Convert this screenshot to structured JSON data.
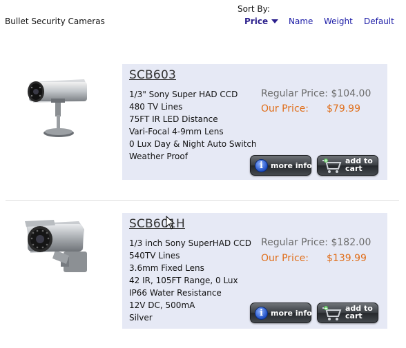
{
  "page": {
    "heading": "Bullet Security Cameras"
  },
  "sort": {
    "label": "Sort By:",
    "options": [
      {
        "label": "Price",
        "active": true
      },
      {
        "label": "Name",
        "active": false
      },
      {
        "label": "Weight",
        "active": false
      },
      {
        "label": "Default",
        "active": false
      }
    ]
  },
  "products": [
    {
      "name": "SCB603",
      "specs": [
        "1/3\" Sony Super HAD CCD",
        "480 TV Lines",
        "75FT IR LED Distance",
        "Vari-Focal 4-9mm Lens",
        "0 Lux Day & Night Auto Switch",
        "Weather Proof"
      ],
      "regular_price_label": "Regular Price:",
      "regular_price": "$104.00",
      "our_price_label": "Our Price:",
      "our_price": "$79.99",
      "more_info_label": "more info",
      "add_to_cart_line1": "add to",
      "add_to_cart_line2": "cart",
      "image_icon": "bullet-camera-on-stand-icon"
    },
    {
      "name": "SCB601H",
      "specs": [
        "1/3 inch Sony SuperHAD CCD",
        "540TV Lines",
        "3.6mm Fixed Lens",
        "42 IR, 105FT Range, 0 Lux",
        "IP66 Water Resistance",
        "12V DC, 500mA",
        "Silver"
      ],
      "regular_price_label": "Regular Price:",
      "regular_price": "$182.00",
      "our_price_label": "Our Price:",
      "our_price": "$139.99",
      "more_info_label": "more info",
      "add_to_cart_line1": "add to",
      "add_to_cart_line2": "cart",
      "image_icon": "bullet-camera-wall-mount-icon"
    }
  ],
  "colors": {
    "panel_background": "#e6e9f5",
    "our_price": "#e06e1a",
    "regular_price": "#6b6b6b",
    "sort_link": "#1a1aa6"
  }
}
